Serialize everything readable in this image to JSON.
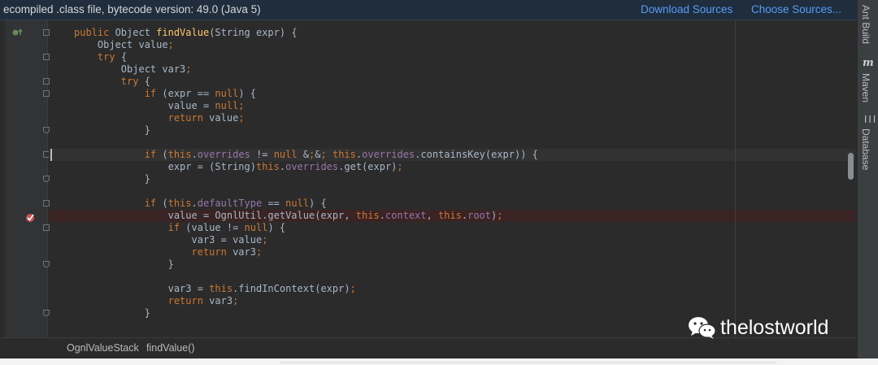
{
  "banner": {
    "message": "ecompiled .class file, bytecode version: 49.0 (Java 5)",
    "download_sources": "Download Sources",
    "choose_sources": "Choose Sources..."
  },
  "code_lines": [
    "public Object findValue(String expr) {",
    "    Object value;",
    "    try {",
    "        Object var3;",
    "        try {",
    "            if (expr == null) {",
    "                value = null;",
    "                return value;",
    "            }",
    "",
    "            if (this.overrides != null && this.overrides.containsKey(expr)) {",
    "                expr = (String)this.overrides.get(expr);",
    "            }",
    "",
    "            if (this.defaultType == null) {",
    "                value = OgnlUtil.getValue(expr, this.context, this.root);",
    "                if (value != null) {",
    "                    var3 = value;",
    "                    return var3;",
    "                }",
    "",
    "                var3 = this.findInContext(expr);",
    "                return var3;",
    "            }"
  ],
  "breadcrumb": [
    "OgnlValueStack",
    "findValue()"
  ],
  "right_tabs": [
    "Ant Build",
    "Maven",
    "Database"
  ],
  "right_tab_icons": {
    "maven": "m",
    "database": "|||"
  },
  "watermark": "thelostworld",
  "colors": {
    "keyword": "#cc7832",
    "field": "#9876aa",
    "text": "#a9b7c6",
    "link": "#589df6",
    "background": "#2b2b2b"
  }
}
